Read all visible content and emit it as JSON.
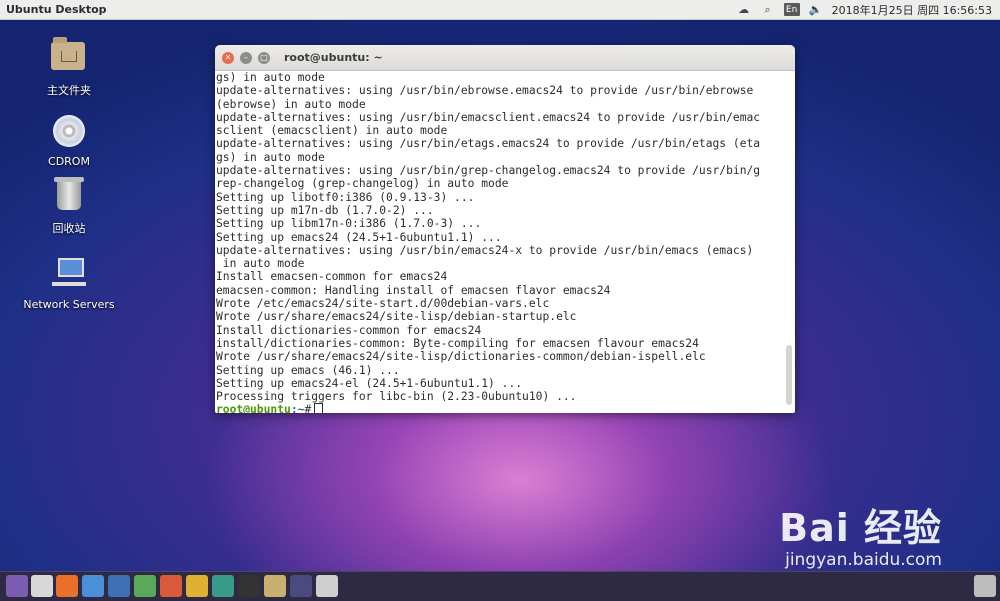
{
  "top_panel": {
    "title": "Ubuntu Desktop",
    "indicators": {
      "lang": "En",
      "datetime": "2018年1月25日 周四 16:56:53"
    }
  },
  "desktop_icons": [
    {
      "label": "主文件夹",
      "icon": "home-folder-icon"
    },
    {
      "label": "CDROM",
      "icon": "cdrom-icon"
    },
    {
      "label": "回收站",
      "icon": "trash-icon"
    },
    {
      "label": "Network Servers",
      "icon": "network-servers-icon"
    }
  ],
  "terminal": {
    "title": "root@ubuntu: ~",
    "lines": [
      "gs) in auto mode",
      "update-alternatives: using /usr/bin/ebrowse.emacs24 to provide /usr/bin/ebrowse",
      "(ebrowse) in auto mode",
      "update-alternatives: using /usr/bin/emacsclient.emacs24 to provide /usr/bin/emac",
      "sclient (emacsclient) in auto mode",
      "update-alternatives: using /usr/bin/etags.emacs24 to provide /usr/bin/etags (eta",
      "gs) in auto mode",
      "update-alternatives: using /usr/bin/grep-changelog.emacs24 to provide /usr/bin/g",
      "rep-changelog (grep-changelog) in auto mode",
      "Setting up libotf0:i386 (0.9.13-3) ...",
      "Setting up m17n-db (1.7.0-2) ...",
      "Setting up libm17n-0:i386 (1.7.0-3) ...",
      "Setting up emacs24 (24.5+1-6ubuntu1.1) ...",
      "update-alternatives: using /usr/bin/emacs24-x to provide /usr/bin/emacs (emacs)",
      " in auto mode",
      "Install emacsen-common for emacs24",
      "emacsen-common: Handling install of emacsen flavor emacs24",
      "Wrote /etc/emacs24/site-start.d/00debian-vars.elc",
      "Wrote /usr/share/emacs24/site-lisp/debian-startup.elc",
      "Install dictionaries-common for emacs24",
      "install/dictionaries-common: Byte-compiling for emacsen flavour emacs24",
      "Wrote /usr/share/emacs24/site-lisp/dictionaries-common/debian-ispell.elc",
      "Setting up emacs (46.1) ...",
      "Setting up emacs24-el (24.5+1-6ubuntu1.1) ...",
      "Processing triggers for libc-bin (2.23-0ubuntu10) ..."
    ],
    "prompt_user": "root@ubuntu",
    "prompt_path": ":~",
    "prompt_symbol": "#"
  },
  "watermark": {
    "brand": "Bai  经验",
    "url": "jingyan.baidu.com"
  },
  "dock": {
    "colors": [
      "#7a5db0",
      "#d8d8d8",
      "#e8702a",
      "#4a8fd8",
      "#3f6fb5",
      "#5aa85a",
      "#d85a3a",
      "#e0b030",
      "#3a9a8a",
      "#333333",
      "#c8b070",
      "#4a4a80",
      "#cfcfcf"
    ]
  }
}
